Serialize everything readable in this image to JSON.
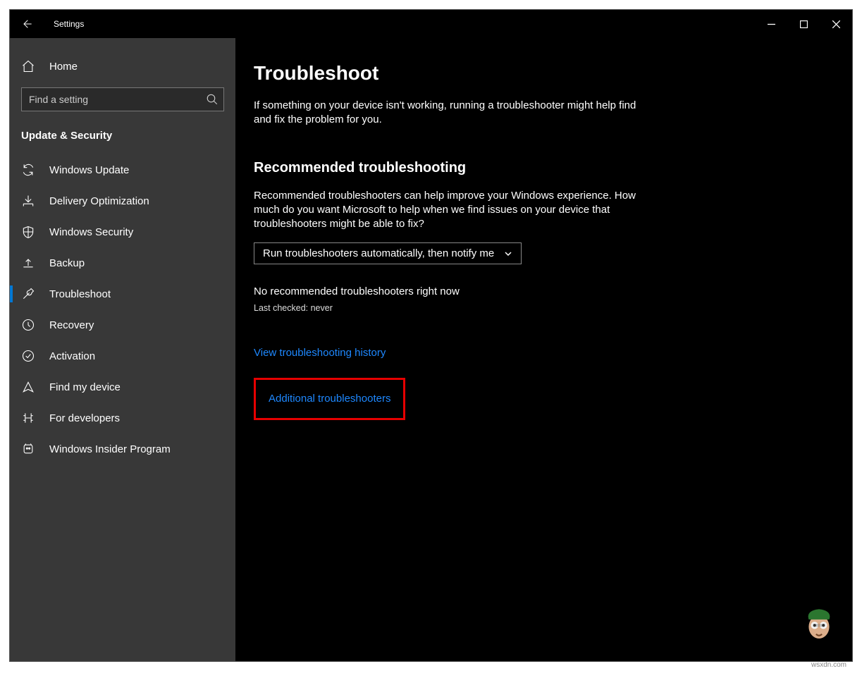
{
  "window": {
    "title": "Settings"
  },
  "sidebar": {
    "home": "Home",
    "search_placeholder": "Find a setting",
    "section": "Update & Security",
    "items": [
      {
        "label": "Windows Update"
      },
      {
        "label": "Delivery Optimization"
      },
      {
        "label": "Windows Security"
      },
      {
        "label": "Backup"
      },
      {
        "label": "Troubleshoot"
      },
      {
        "label": "Recovery"
      },
      {
        "label": "Activation"
      },
      {
        "label": "Find my device"
      },
      {
        "label": "For developers"
      },
      {
        "label": "Windows Insider Program"
      }
    ]
  },
  "main": {
    "heading": "Troubleshoot",
    "intro": "If something on your device isn't working, running a troubleshooter might help find and fix the problem for you.",
    "rec_heading": "Recommended troubleshooting",
    "rec_desc": "Recommended troubleshooters can help improve your Windows experience. How much do you want Microsoft to help when we find issues on your device that troubleshooters might be able to fix?",
    "dropdown": "Run troubleshooters automatically, then notify me",
    "no_rec": "No recommended troubleshooters right now",
    "last_checked": "Last checked: never",
    "history_link": "View troubleshooting history",
    "additional_link": "Additional troubleshooters"
  },
  "credit": "wsxdn.com"
}
